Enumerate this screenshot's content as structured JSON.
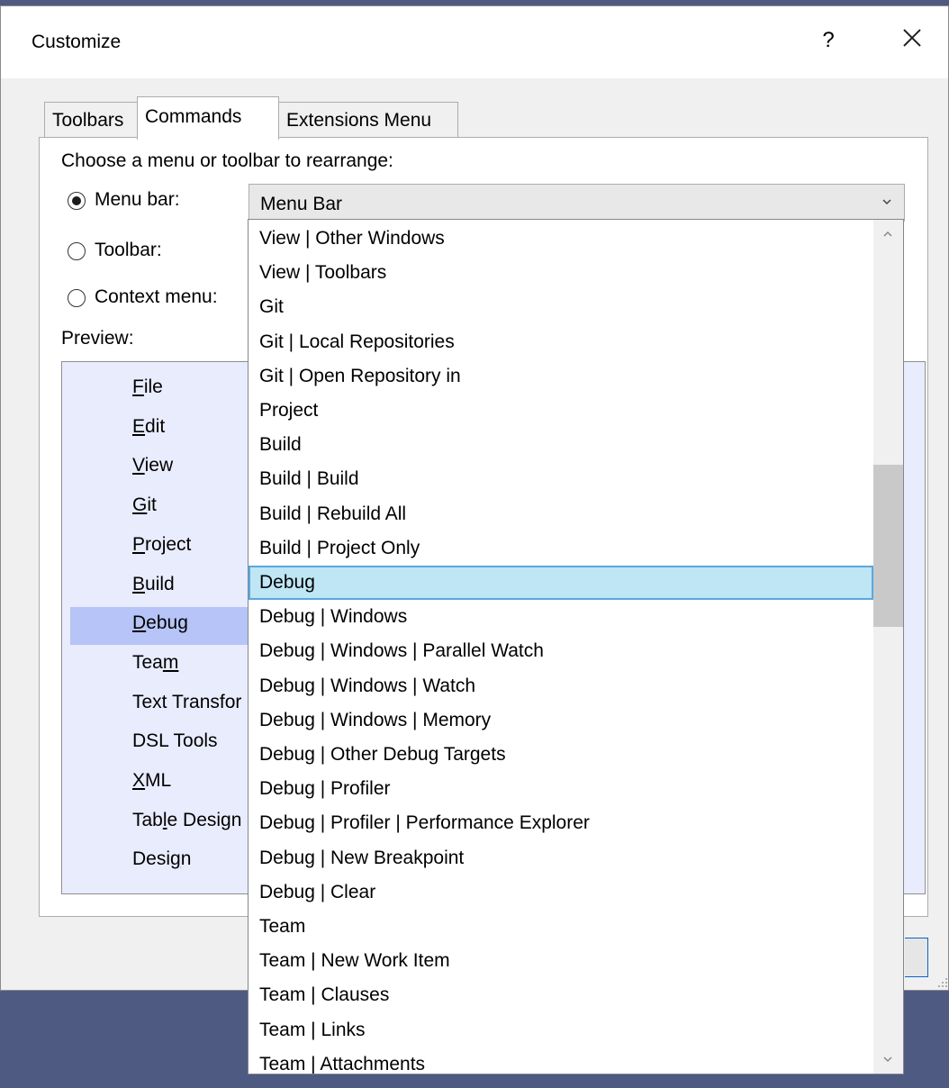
{
  "dialog": {
    "title": "Customize",
    "help_label": "?",
    "close_icon": "close-icon"
  },
  "tabs": [
    {
      "label": "Toolbars",
      "active": false
    },
    {
      "label": "Commands",
      "active": true
    },
    {
      "label": "Extensions Menu",
      "active": false
    }
  ],
  "choose_label": "Choose a menu or toolbar to rearrange:",
  "radios": [
    {
      "label": "Menu bar:",
      "checked": true
    },
    {
      "label": "Toolbar:",
      "checked": false
    },
    {
      "label": "Context menu:",
      "checked": false
    }
  ],
  "combo": {
    "value": "Menu Bar"
  },
  "preview": {
    "label": "Preview:",
    "items": [
      {
        "pre": "",
        "accel": "F",
        "post": "ile"
      },
      {
        "pre": "",
        "accel": "E",
        "post": "dit"
      },
      {
        "pre": "",
        "accel": "V",
        "post": "iew"
      },
      {
        "pre": "",
        "accel": "G",
        "post": "it"
      },
      {
        "pre": "",
        "accel": "P",
        "post": "roject"
      },
      {
        "pre": "",
        "accel": "B",
        "post": "uild"
      },
      {
        "pre": "",
        "accel": "D",
        "post": "ebug"
      },
      {
        "pre": "Tea",
        "accel": "m",
        "post": ""
      },
      {
        "pre": "Text Transfor",
        "accel": "",
        "post": ""
      },
      {
        "pre": "DSL Tools",
        "accel": "",
        "post": ""
      },
      {
        "pre": "",
        "accel": "X",
        "post": "ML"
      },
      {
        "pre": "Tab",
        "accel": "l",
        "post": "e Design"
      },
      {
        "pre": "Desi",
        "accel": "g",
        "post": "n"
      }
    ],
    "selected_index": 6
  },
  "dropdown": {
    "items": [
      "View | Other Windows",
      "View | Toolbars",
      "Git",
      "Git | Local Repositories",
      "Git | Open Repository in",
      "Project",
      "Build",
      "Build | Build",
      "Build | Rebuild All",
      "Build | Project Only",
      "Debug",
      "Debug | Windows",
      "Debug | Windows | Parallel Watch",
      "Debug | Windows | Watch",
      "Debug | Windows | Memory",
      "Debug | Other Debug Targets",
      "Debug | Profiler",
      "Debug | Profiler | Performance Explorer",
      "Debug | New Breakpoint",
      "Debug | Clear",
      "Team",
      "Team | New Work Item",
      "Team | Clauses",
      "Team | Links",
      "Team | Attachments"
    ],
    "selected_index": 10
  },
  "colors": {
    "desktop": "#4f5a82",
    "dropdown_selected": "#bee6f5",
    "preview_bg": "#e9ecfd",
    "preview_selected": "#b6c4f7"
  }
}
